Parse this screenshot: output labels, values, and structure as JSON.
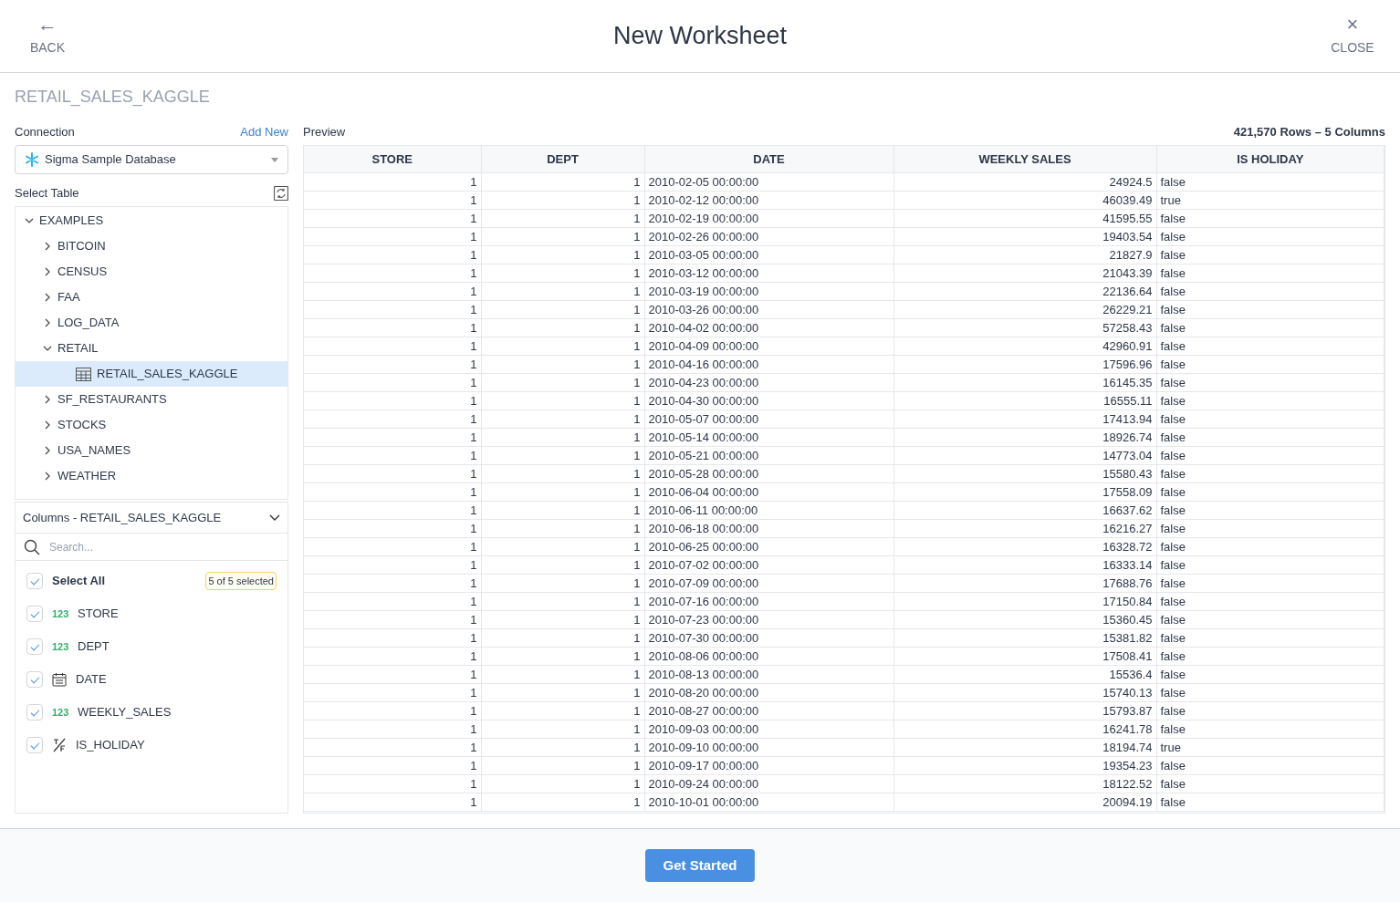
{
  "header": {
    "back": {
      "icon": "←",
      "label": "BACK"
    },
    "title": "New Worksheet",
    "close": {
      "icon": "×",
      "label": "CLOSE"
    }
  },
  "source_title": "RETAIL_SALES_KAGGLE",
  "connection": {
    "label": "Connection",
    "add_new": "Add New",
    "value": "Sigma Sample Database"
  },
  "select_table": {
    "label": "Select Table",
    "tree": [
      {
        "label": "EXAMPLES",
        "kind": "folder",
        "expanded": true,
        "selected": false,
        "children": [
          {
            "label": "BITCOIN",
            "kind": "folder",
            "expanded": false,
            "selected": false
          },
          {
            "label": "CENSUS",
            "kind": "folder",
            "expanded": false,
            "selected": false
          },
          {
            "label": "FAA",
            "kind": "folder",
            "expanded": false,
            "selected": false
          },
          {
            "label": "LOG_DATA",
            "kind": "folder",
            "expanded": false,
            "selected": false
          },
          {
            "label": "RETAIL",
            "kind": "folder",
            "expanded": true,
            "selected": false,
            "children": [
              {
                "label": "RETAIL_SALES_KAGGLE",
                "kind": "table",
                "selected": true
              }
            ]
          },
          {
            "label": "SF_RESTAURANTS",
            "kind": "folder",
            "expanded": false,
            "selected": false
          },
          {
            "label": "STOCKS",
            "kind": "folder",
            "expanded": false,
            "selected": false
          },
          {
            "label": "USA_NAMES",
            "kind": "folder",
            "expanded": false,
            "selected": false
          },
          {
            "label": "WEATHER",
            "kind": "folder",
            "expanded": false,
            "selected": false
          }
        ]
      }
    ]
  },
  "columns_panel": {
    "title": "Columns - RETAIL_SALES_KAGGLE",
    "search_placeholder": "Search...",
    "select_all": {
      "label": "Select All",
      "checked": true
    },
    "badge": "5 of 5 selected",
    "items": [
      {
        "type_label": "123",
        "kind": "number",
        "label": "STORE",
        "checked": true
      },
      {
        "type_label": "123",
        "kind": "number",
        "label": "DEPT",
        "checked": true
      },
      {
        "kind": "date",
        "label": "DATE",
        "checked": true
      },
      {
        "type_label": "123",
        "kind": "number",
        "label": "WEEKLY_SALES",
        "checked": true
      },
      {
        "kind": "boolean",
        "label": "IS_HOLIDAY",
        "checked": true
      }
    ]
  },
  "preview": {
    "label": "Preview",
    "summary": "421,570 Rows – 5 Columns",
    "columns": [
      "STORE",
      "DEPT",
      "DATE",
      "WEEKLY SALES",
      "IS HOLIDAY"
    ],
    "rows": [
      [
        "1",
        "1",
        "2010-02-05 00:00:00",
        "24924.5",
        "false"
      ],
      [
        "1",
        "1",
        "2010-02-12 00:00:00",
        "46039.49",
        "true"
      ],
      [
        "1",
        "1",
        "2010-02-19 00:00:00",
        "41595.55",
        "false"
      ],
      [
        "1",
        "1",
        "2010-02-26 00:00:00",
        "19403.54",
        "false"
      ],
      [
        "1",
        "1",
        "2010-03-05 00:00:00",
        "21827.9",
        "false"
      ],
      [
        "1",
        "1",
        "2010-03-12 00:00:00",
        "21043.39",
        "false"
      ],
      [
        "1",
        "1",
        "2010-03-19 00:00:00",
        "22136.64",
        "false"
      ],
      [
        "1",
        "1",
        "2010-03-26 00:00:00",
        "26229.21",
        "false"
      ],
      [
        "1",
        "1",
        "2010-04-02 00:00:00",
        "57258.43",
        "false"
      ],
      [
        "1",
        "1",
        "2010-04-09 00:00:00",
        "42960.91",
        "false"
      ],
      [
        "1",
        "1",
        "2010-04-16 00:00:00",
        "17596.96",
        "false"
      ],
      [
        "1",
        "1",
        "2010-04-23 00:00:00",
        "16145.35",
        "false"
      ],
      [
        "1",
        "1",
        "2010-04-30 00:00:00",
        "16555.11",
        "false"
      ],
      [
        "1",
        "1",
        "2010-05-07 00:00:00",
        "17413.94",
        "false"
      ],
      [
        "1",
        "1",
        "2010-05-14 00:00:00",
        "18926.74",
        "false"
      ],
      [
        "1",
        "1",
        "2010-05-21 00:00:00",
        "14773.04",
        "false"
      ],
      [
        "1",
        "1",
        "2010-05-28 00:00:00",
        "15580.43",
        "false"
      ],
      [
        "1",
        "1",
        "2010-06-04 00:00:00",
        "17558.09",
        "false"
      ],
      [
        "1",
        "1",
        "2010-06-11 00:00:00",
        "16637.62",
        "false"
      ],
      [
        "1",
        "1",
        "2010-06-18 00:00:00",
        "16216.27",
        "false"
      ],
      [
        "1",
        "1",
        "2010-06-25 00:00:00",
        "16328.72",
        "false"
      ],
      [
        "1",
        "1",
        "2010-07-02 00:00:00",
        "16333.14",
        "false"
      ],
      [
        "1",
        "1",
        "2010-07-09 00:00:00",
        "17688.76",
        "false"
      ],
      [
        "1",
        "1",
        "2010-07-16 00:00:00",
        "17150.84",
        "false"
      ],
      [
        "1",
        "1",
        "2010-07-23 00:00:00",
        "15360.45",
        "false"
      ],
      [
        "1",
        "1",
        "2010-07-30 00:00:00",
        "15381.82",
        "false"
      ],
      [
        "1",
        "1",
        "2010-08-06 00:00:00",
        "17508.41",
        "false"
      ],
      [
        "1",
        "1",
        "2010-08-13 00:00:00",
        "15536.4",
        "false"
      ],
      [
        "1",
        "1",
        "2010-08-20 00:00:00",
        "15740.13",
        "false"
      ],
      [
        "1",
        "1",
        "2010-08-27 00:00:00",
        "15793.87",
        "false"
      ],
      [
        "1",
        "1",
        "2010-09-03 00:00:00",
        "16241.78",
        "false"
      ],
      [
        "1",
        "1",
        "2010-09-10 00:00:00",
        "18194.74",
        "true"
      ],
      [
        "1",
        "1",
        "2010-09-17 00:00:00",
        "19354.23",
        "false"
      ],
      [
        "1",
        "1",
        "2010-09-24 00:00:00",
        "18122.52",
        "false"
      ],
      [
        "1",
        "1",
        "2010-10-01 00:00:00",
        "20094.19",
        "false"
      ]
    ]
  },
  "footer": {
    "button": "Get Started"
  }
}
